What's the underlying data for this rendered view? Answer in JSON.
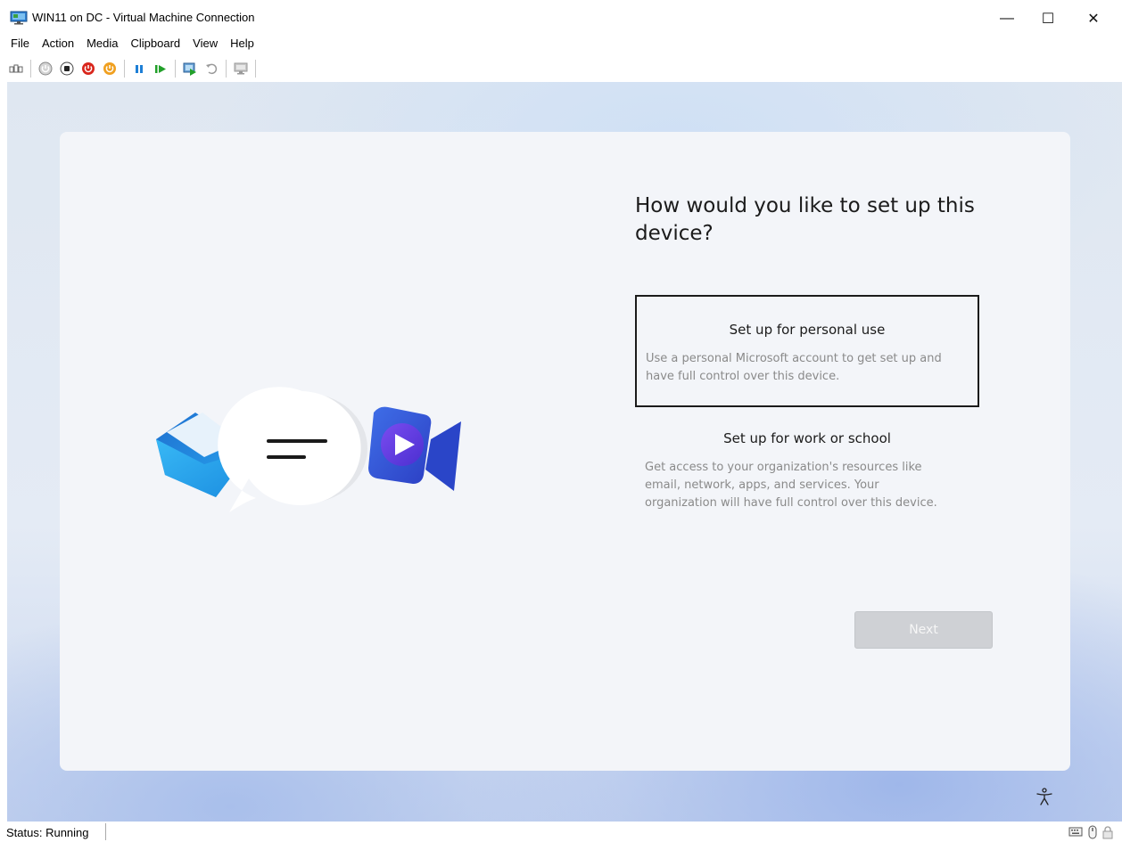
{
  "window": {
    "title": "WIN11 on DC - Virtual Machine Connection",
    "controls": {
      "minimize": "—",
      "maximize": "☐",
      "close": "✕"
    }
  },
  "menu": {
    "items": [
      "File",
      "Action",
      "Media",
      "Clipboard",
      "View",
      "Help"
    ]
  },
  "toolbar": {
    "icons": [
      "ctrl-alt-del-icon",
      "start-icon",
      "turn-off-icon",
      "shut-down-icon",
      "save-state-icon",
      "pause-icon",
      "reset-icon",
      "checkpoint-icon",
      "revert-icon",
      "enhanced-session-icon"
    ],
    "colors": {
      "pause": "#1e7fd6",
      "reset": "#22a02a",
      "shutdown": "#d9261c",
      "save": "#f0a020"
    }
  },
  "oobe": {
    "heading": "How would you like to set up this device?",
    "options": [
      {
        "title": "Set up for personal use",
        "description": "Use a personal Microsoft account to get set up and have full control over this device.",
        "selected": true
      },
      {
        "title": "Set up for work or school",
        "description": "Get access to your organization's resources like email, network, apps, and services. Your organization will have full control over this device.",
        "selected": false
      }
    ],
    "next_label": "Next",
    "accessibility_icon": "accessibility-icon"
  },
  "status": {
    "text": "Status: Running",
    "tray_icons": [
      "keyboard-icon",
      "mouse-icon",
      "lock-icon"
    ]
  }
}
